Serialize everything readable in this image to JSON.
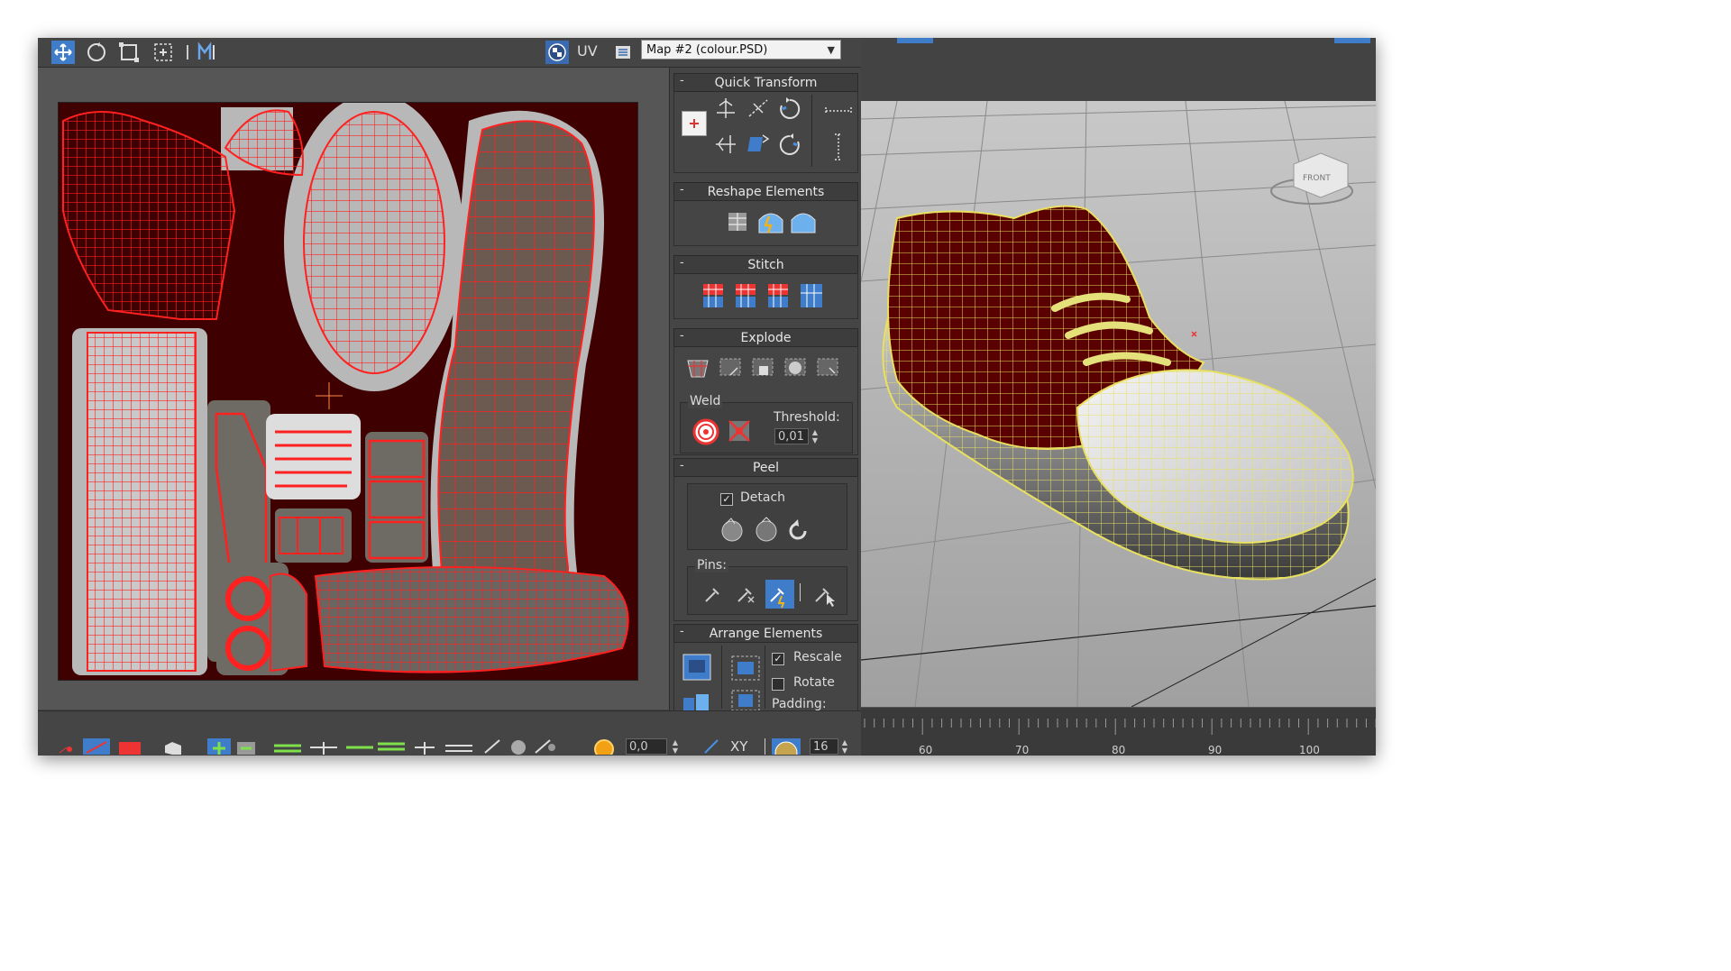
{
  "toolbar": {
    "tools": [
      "move-tool-icon",
      "rotate-tool-icon",
      "scale-tool-icon",
      "freeform-tool-icon",
      "mirror-icon"
    ],
    "uv_label": "UV",
    "map_select": "Map #2 (colour.PSD)"
  },
  "panel": {
    "quick_transform": "Quick Transform",
    "reshape_elements": "Reshape Elements",
    "stitch": "Stitch",
    "explode": "Explode",
    "weld_label": "Weld",
    "threshold_label": "Threshold:",
    "threshold_value": "0,01",
    "peel": "Peel",
    "detach_label": "Detach",
    "detach_checked": true,
    "pins_label": "Pins:",
    "arrange_elements": "Arrange Elements",
    "rescale_label": "Rescale",
    "rescale_checked": true,
    "rotate_label": "Rotate",
    "rotate_checked": false,
    "padding_label": "Padding:",
    "collapse_symbol": "-"
  },
  "bottom": {
    "value_field": "0,0",
    "xy_label": "XY",
    "count_field": "16"
  },
  "viewport": {
    "viewcube_label": "FRONT",
    "timeline_ticks": [
      "60",
      "70",
      "80",
      "90",
      "100"
    ]
  },
  "colors": {
    "uv_background": "#3e0000",
    "wire_red": "#ff2020",
    "active_blue": "#3f7cc9",
    "wire_yellow": "#e8e060"
  }
}
